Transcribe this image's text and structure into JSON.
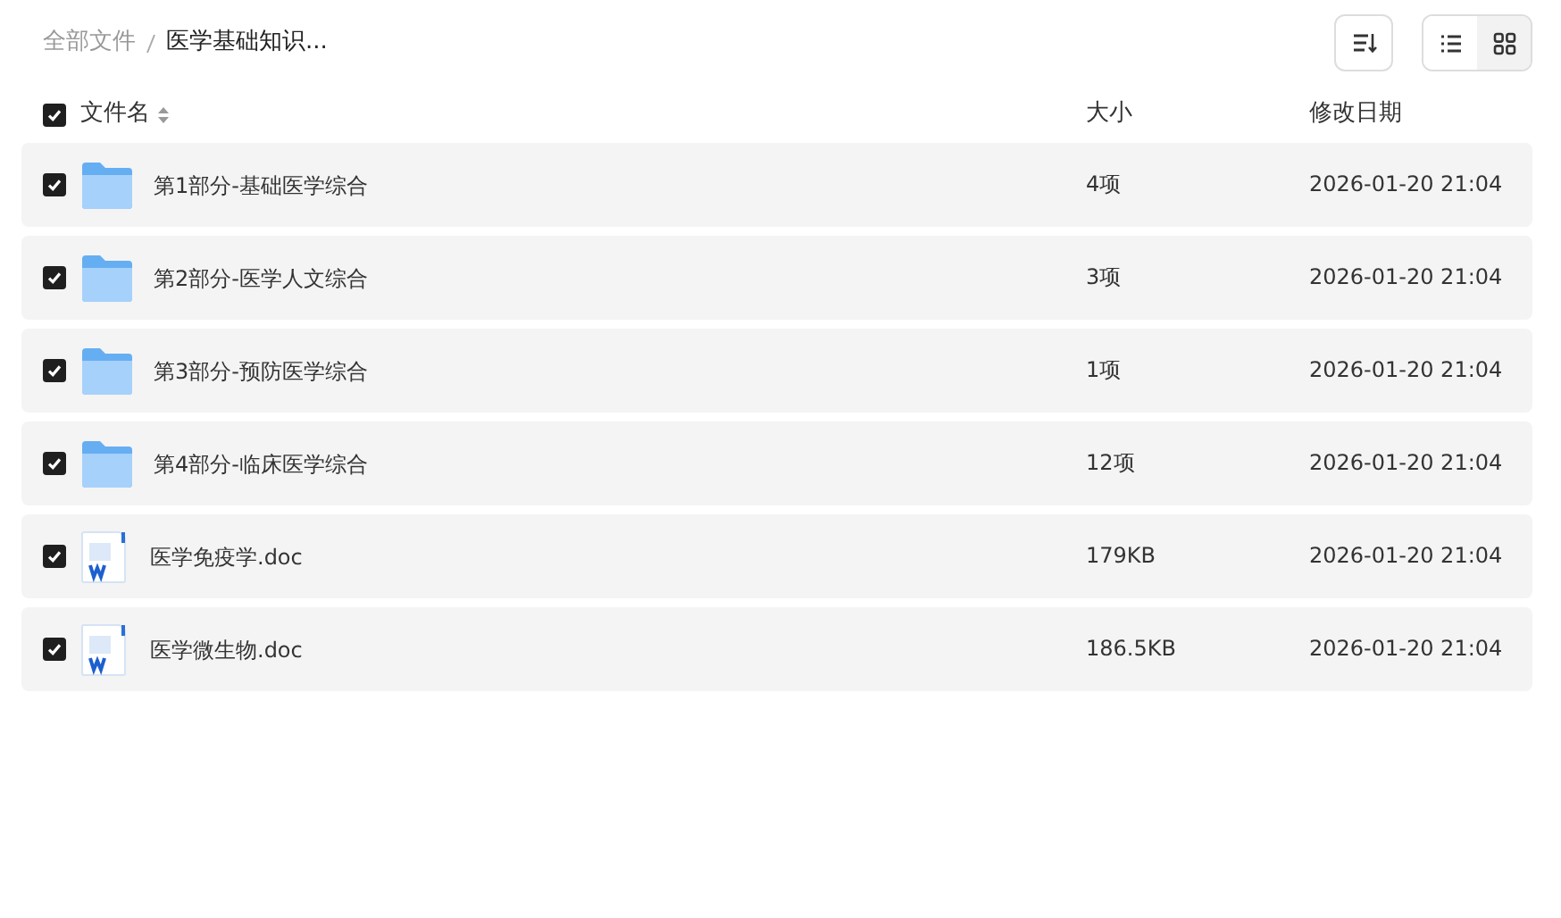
{
  "breadcrumb": [
    {
      "label": "全部文件",
      "current": false
    },
    {
      "label": "医学基础知识...",
      "current": true
    }
  ],
  "toolbar": {
    "view_modes": [
      {
        "kind": "list",
        "selected": false
      },
      {
        "kind": "grid",
        "selected": true
      }
    ]
  },
  "table": {
    "select_all": {
      "checked": true
    },
    "columns": [
      "文件名",
      "大小",
      "修改日期"
    ],
    "rows": [
      {
        "kind": "folder",
        "name": "第1部分-基础医学综合",
        "size": "4项",
        "modified": "2026-01-20 21:04",
        "checked": true
      },
      {
        "kind": "folder",
        "name": "第2部分-医学人文综合",
        "size": "3项",
        "modified": "2026-01-20 21:04",
        "checked": true
      },
      {
        "kind": "folder",
        "name": "第3部分-预防医学综合",
        "size": "1项",
        "modified": "2026-01-20 21:04",
        "checked": true
      },
      {
        "kind": "folder",
        "name": "第4部分-临床医学综合",
        "size": "12项",
        "modified": "2026-01-20 21:04",
        "checked": true
      },
      {
        "kind": "doc",
        "name": "医学免疫学.doc",
        "size": "179KB",
        "modified": "2026-01-20 21:04",
        "checked": true
      },
      {
        "kind": "doc",
        "name": "医学微生物.doc",
        "size": "186.5KB",
        "modified": "2026-01-20 21:04",
        "checked": true
      }
    ]
  }
}
